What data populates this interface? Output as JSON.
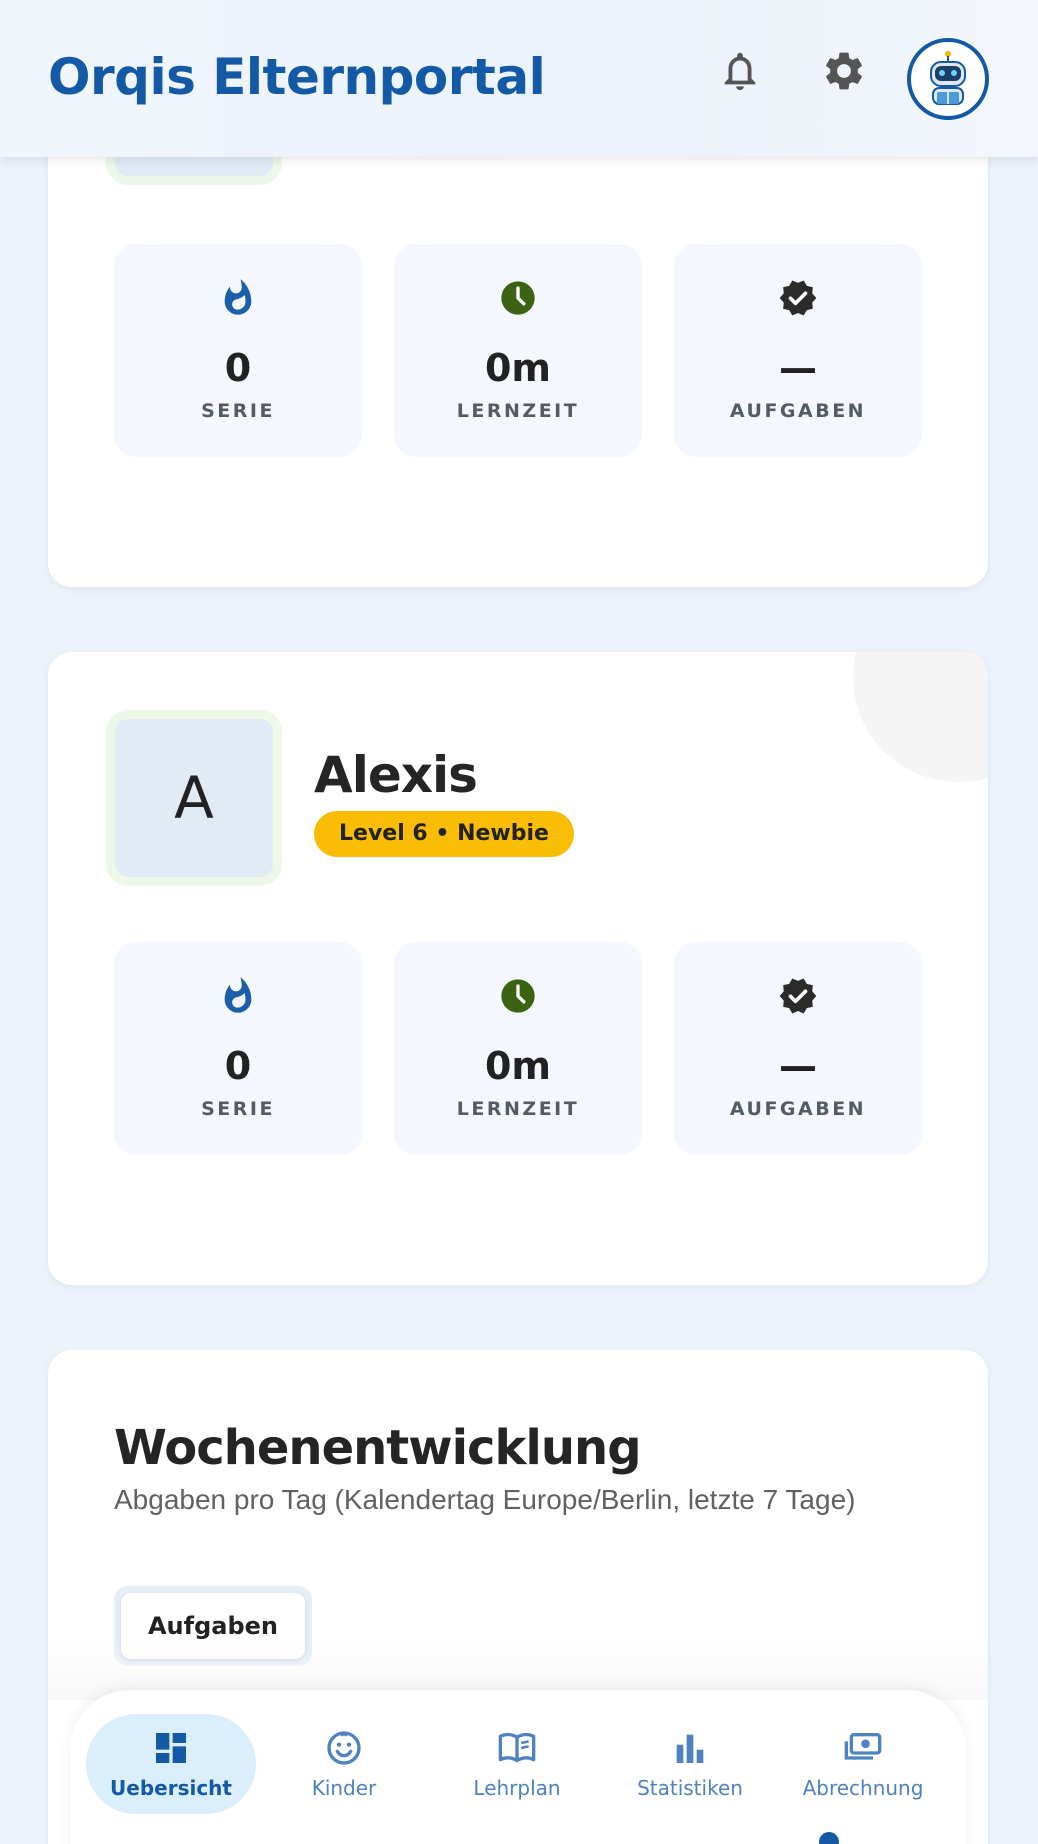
{
  "header": {
    "title": "Orqis Elternportal",
    "icons": [
      "bell-icon",
      "gear-icon",
      "robot-avatar"
    ]
  },
  "child_card_1": {
    "stats": [
      {
        "icon": "flame-icon",
        "value": "0",
        "label": "SERIE"
      },
      {
        "icon": "clock-icon",
        "value": "0m",
        "label": "LERNZEIT"
      },
      {
        "icon": "verified-badge-icon",
        "value": "—",
        "label": "AUFGABEN"
      }
    ]
  },
  "child_card_2": {
    "initial": "A",
    "name": "Alexis",
    "level": "Level 6 • Newbie",
    "stats": [
      {
        "icon": "flame-icon",
        "value": "0",
        "label": "SERIE"
      },
      {
        "icon": "clock-icon",
        "value": "0m",
        "label": "LERNZEIT"
      },
      {
        "icon": "verified-badge-icon",
        "value": "—",
        "label": "AUFGABEN"
      }
    ]
  },
  "weekly": {
    "title": "Wochenentwicklung",
    "subtitle": "Abgaben pro Tag (Kalendertag Europe/Berlin, letzte 7 Tage)",
    "toggle_label": "Aufgaben"
  },
  "nav": {
    "items": [
      {
        "label": "Uebersicht",
        "icon": "dashboard-icon",
        "active": true
      },
      {
        "label": "Kinder",
        "icon": "smiley-icon",
        "active": false
      },
      {
        "label": "Lehrplan",
        "icon": "book-icon",
        "active": false
      },
      {
        "label": "Statistiken",
        "icon": "bar-chart-icon",
        "active": false
      },
      {
        "label": "Abrechnung",
        "icon": "money-icon",
        "active": false
      }
    ]
  },
  "colors": {
    "brand": "#1359a6",
    "flame": "#1a5fa8",
    "clock": "#3b6312",
    "badge": "#2b2b2b",
    "level_pill": "#f9bd06",
    "nav_active_bg": "#dbeefc",
    "nav_inactive": "#4e82c0"
  }
}
